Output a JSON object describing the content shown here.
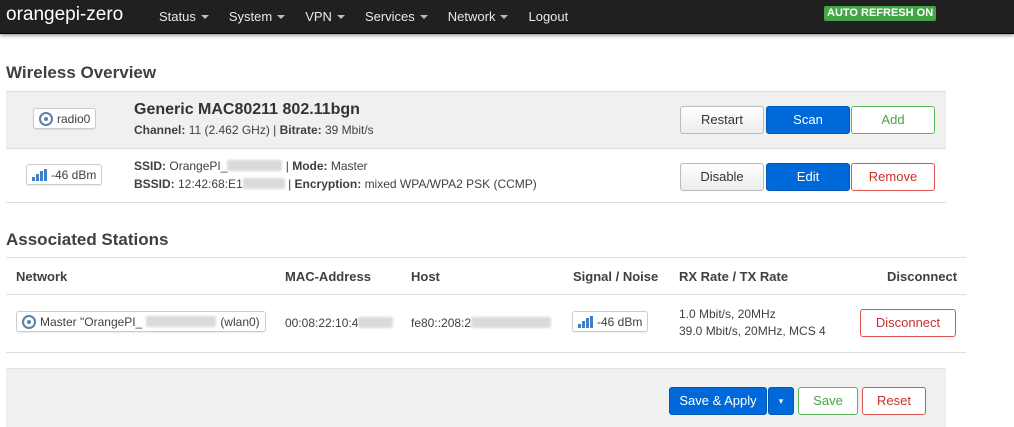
{
  "navbar": {
    "brand": "orangepi-zero",
    "menu": [
      "Status",
      "System",
      "VPN",
      "Services",
      "Network"
    ],
    "logout": "Logout",
    "auto_refresh": "AUTO REFRESH ON"
  },
  "wireless": {
    "heading": "Wireless Overview",
    "device": {
      "badge": "radio0",
      "title": "Generic MAC80211 802.11bgn",
      "channel_label": "Channel:",
      "channel_value": "11 (2.462 GHz)",
      "bitrate_label": "Bitrate:",
      "bitrate_value": "39 Mbit/s",
      "buttons": {
        "restart": "Restart",
        "scan": "Scan",
        "add": "Add"
      }
    },
    "network": {
      "signal": "-46 dBm",
      "ssid_label": "SSID:",
      "ssid_value": "OrangePI_",
      "mode_label": "Mode:",
      "mode_value": "Master",
      "bssid_label": "BSSID:",
      "bssid_value": "12:42:68:E1",
      "encryption_label": "Encryption:",
      "encryption_value": "mixed WPA/WPA2 PSK (CCMP)",
      "buttons": {
        "disable": "Disable",
        "edit": "Edit",
        "remove": "Remove"
      }
    }
  },
  "stations": {
    "heading": "Associated Stations",
    "columns": {
      "network": "Network",
      "mac": "MAC-Address",
      "host": "Host",
      "signal": "Signal / Noise",
      "rate": "RX Rate / TX Rate",
      "disconnect": "Disconnect"
    },
    "rows": [
      {
        "network_prefix": "Master \"OrangePI_",
        "network_suffix": "(wlan0)",
        "mac": "00:08:22:10:4",
        "host": "fe80::208:2",
        "signal": "-46 dBm",
        "rx": "1.0 Mbit/s, 20MHz",
        "tx": "39.0 Mbit/s, 20MHz, MCS 4",
        "disconnect": "Disconnect"
      }
    ]
  },
  "footer": {
    "save_apply": "Save & Apply",
    "save": "Save",
    "reset": "Reset"
  }
}
